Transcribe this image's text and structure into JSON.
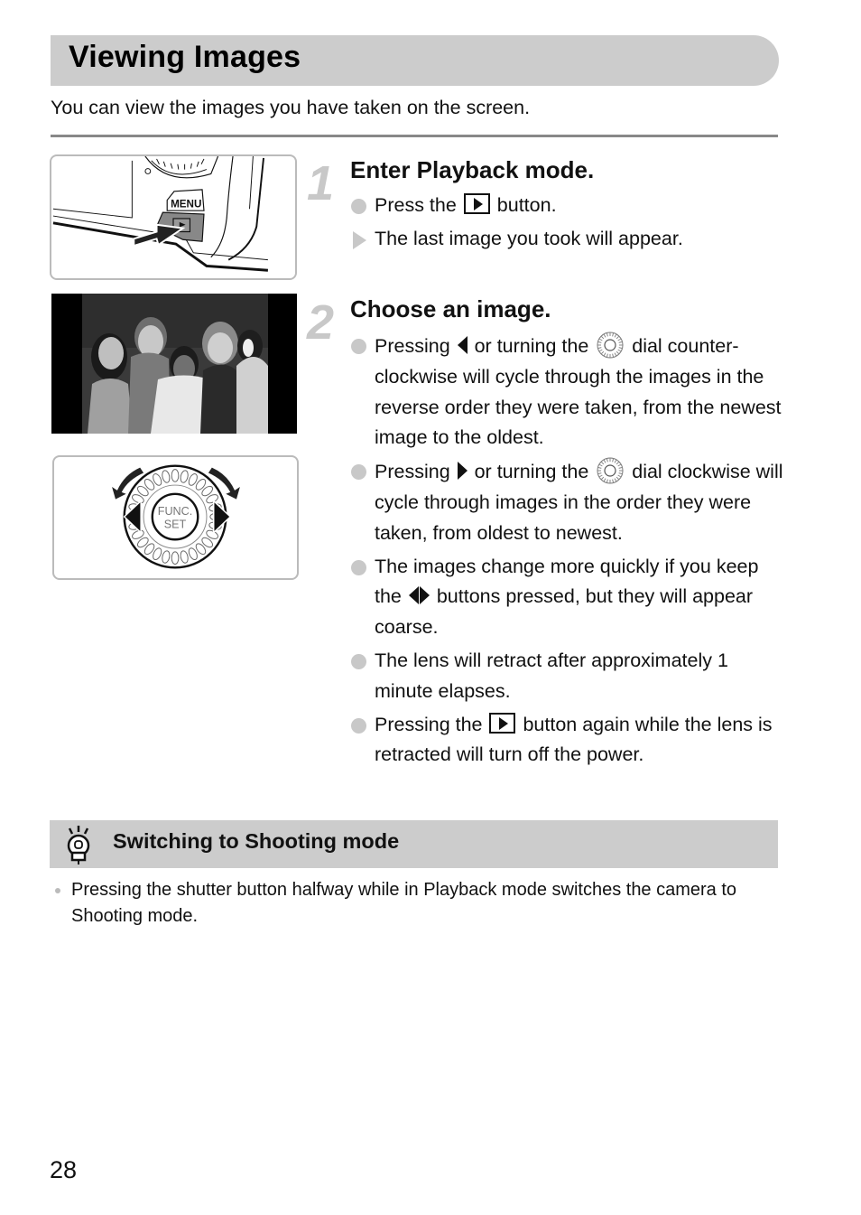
{
  "page": {
    "title": "Viewing Images",
    "intro": "You can view the images you have taken on the screen.",
    "page_number": "28"
  },
  "figures": {
    "camera": {
      "menu_label": "MENU",
      "icon": "playback-button-press-illustration"
    },
    "photo": {
      "description": "Playback image of four children and a dog"
    },
    "dial": {
      "func_label": "FUNC.",
      "set_label": "SET",
      "icon": "control-dial-illustration"
    }
  },
  "steps": [
    {
      "number": "1",
      "title": "Enter Playback mode.",
      "bullets": [
        {
          "type": "dot",
          "parts": [
            "Press the ",
            "play-icon",
            " button."
          ]
        },
        {
          "type": "result",
          "text": "The last image you took will appear."
        }
      ]
    },
    {
      "number": "2",
      "title": "Choose an image.",
      "bullets": [
        {
          "type": "dot",
          "before": "Pressing ",
          "mid1": " or turning the ",
          "after": " dial counter-clockwise will cycle through the images in the reverse order they were taken, from the newest image to the oldest."
        },
        {
          "type": "dot",
          "before": "Pressing ",
          "mid1": " or turning the ",
          "after": " dial clockwise will cycle through images in the order they were taken, from oldest to newest."
        },
        {
          "type": "dot",
          "before": "The images change more quickly if you keep the ",
          "after": " buttons pressed, but they will appear coarse."
        },
        {
          "type": "dot",
          "text": "The lens will retract after approximately 1 minute elapses."
        },
        {
          "type": "dot",
          "before": "Pressing the ",
          "after": " button again while the lens is retracted will turn off the power."
        }
      ]
    }
  ],
  "tip": {
    "icon": "lightbulb-icon",
    "title": "Switching to Shooting mode",
    "text": "Pressing the shutter button halfway while in Playback mode switches the camera to Shooting mode."
  },
  "icons": {
    "play": "play-icon",
    "left": "left-arrow-icon",
    "right": "right-arrow-icon",
    "dial": "control-dial-icon"
  },
  "colors": {
    "title_bar": "#cccccc",
    "rule": "#888888",
    "step_number": "#c8c8c8",
    "bullet": "#c8c8c8"
  }
}
